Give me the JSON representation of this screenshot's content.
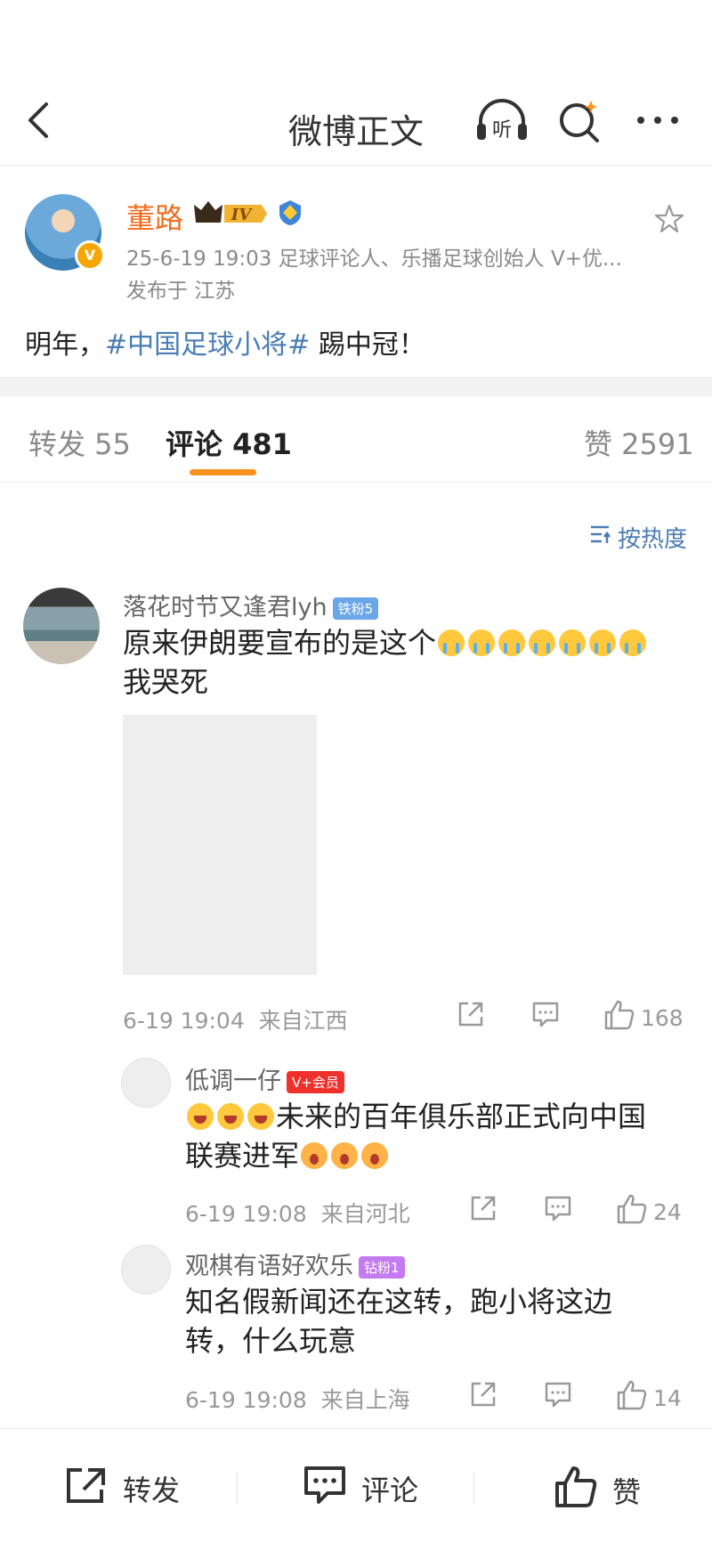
{
  "header": {
    "title": "微博正文",
    "listen_label": "听"
  },
  "post": {
    "author": "董路",
    "level_badge": "IV",
    "verified_mark": "V",
    "meta": "25-6-19 19:03   足球评论人、乐播足球创始人 V+优...",
    "location": "发布于 江苏",
    "text_before": "明年，",
    "hashtag": "#中国足球小将#",
    "text_after": " 踢中冠！"
  },
  "tabs": {
    "repost": "转发 55",
    "comment": "评论 481",
    "like": "赞 2591"
  },
  "sort_label": "按热度",
  "comments": [
    {
      "name": "落花时节又逢君lyh",
      "badge": "铁粉5",
      "badge_color": "#6aa6e8",
      "text_main": "原来伊朗要宣布的是这个",
      "text_end": "我哭死",
      "time": "6-19 19:04",
      "source": "来自江西",
      "likes": "168"
    },
    {
      "name": "低调一仔",
      "badge": "V+会员",
      "badge_color": "#f0302a",
      "text_line1": "未来的百年俱乐部正式向中国",
      "text_line2": "联赛进军",
      "time": "6-19 19:08",
      "source": "来自河北",
      "likes": "24"
    },
    {
      "name": "观棋有语好欢乐",
      "badge": "钻粉1",
      "badge_color": "#c57bf0",
      "text_line1": "知名假新闻还在这转，跑小将这边",
      "text_line2": "转，什么玩意",
      "time": "6-19 19:08",
      "source": "来自上海",
      "likes": "14"
    }
  ],
  "bottom_bar": {
    "repost": "转发",
    "comment": "评论",
    "like": "赞"
  },
  "colors": {
    "accent": "#f7931e",
    "link": "#4a7db5",
    "username": "#f26b1d"
  }
}
